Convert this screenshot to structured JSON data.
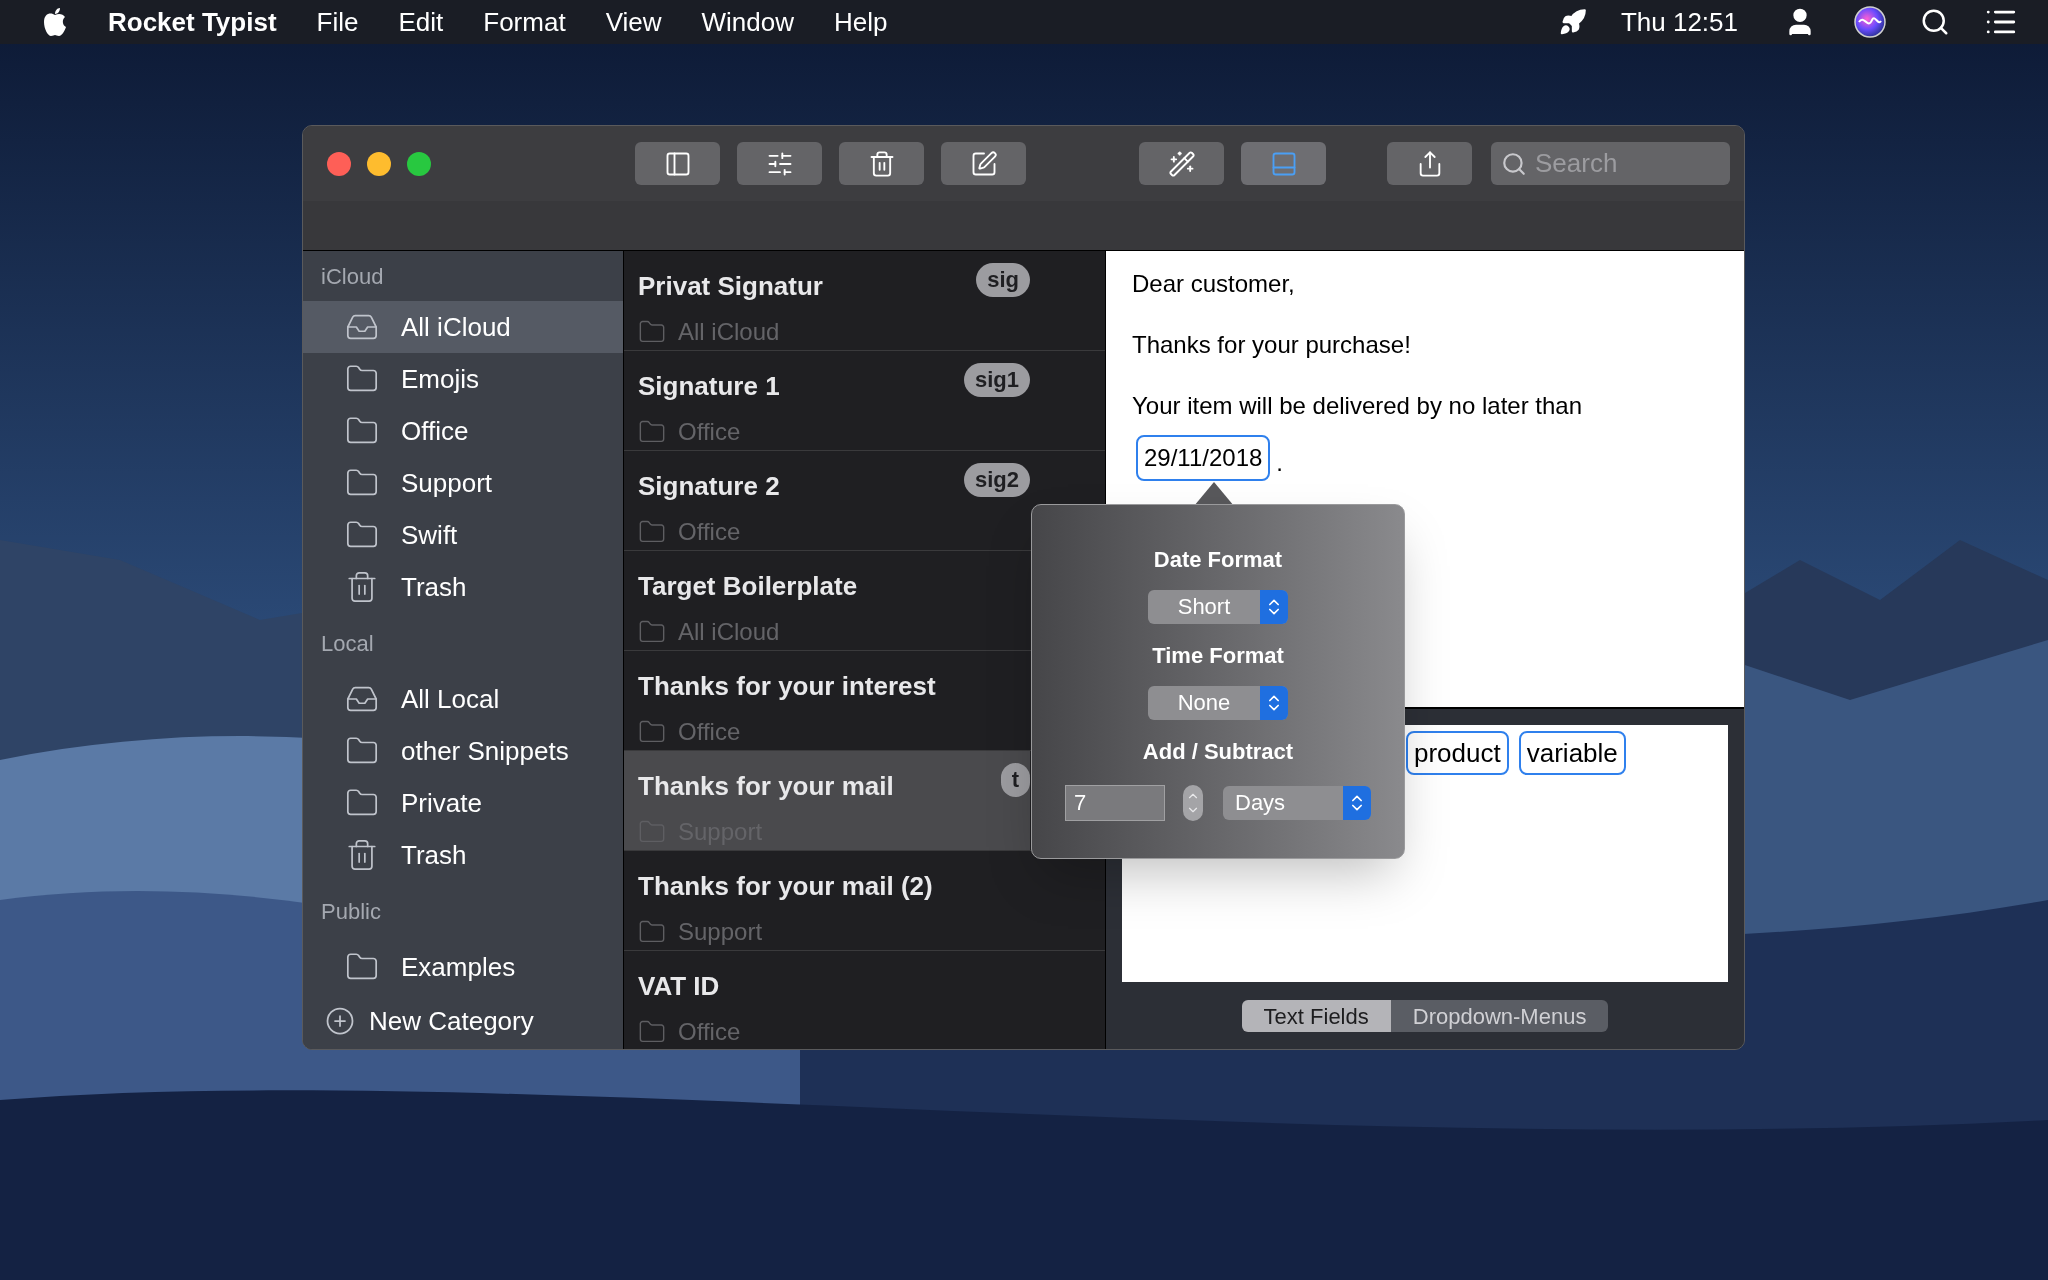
{
  "menu_bar": {
    "app_name": "Rocket Typist",
    "menus": [
      "File",
      "Edit",
      "Format",
      "View",
      "Window",
      "Help"
    ],
    "clock": "Thu 12:51"
  },
  "toolbar": {
    "buttons": [
      {
        "kind": "sidebar",
        "on": false
      },
      {
        "kind": "filters",
        "on": false
      },
      {
        "kind": "trash",
        "on": false
      },
      {
        "kind": "compose",
        "on": false
      },
      {
        "kind": "wand",
        "on": false
      },
      {
        "kind": "preview",
        "on": true
      },
      {
        "kind": "share",
        "on": false
      }
    ],
    "search_placeholder": "Search"
  },
  "sidebar": {
    "sections": [
      {
        "title": "iCloud",
        "items": [
          {
            "label": "All iCloud",
            "kind": "all",
            "selected": true
          },
          {
            "label": "Emojis",
            "kind": "folder",
            "selected": false
          },
          {
            "label": "Office",
            "kind": "folder",
            "selected": false
          },
          {
            "label": "Support",
            "kind": "folder",
            "selected": false
          },
          {
            "label": "Swift",
            "kind": "folder",
            "selected": false
          },
          {
            "label": "Trash",
            "kind": "trash",
            "selected": false
          }
        ]
      },
      {
        "title": "Local",
        "items": [
          {
            "label": "All Local",
            "kind": "all",
            "selected": false
          },
          {
            "label": "other Snippets",
            "kind": "folder",
            "selected": false
          },
          {
            "label": "Private",
            "kind": "folder",
            "selected": false
          },
          {
            "label": "Trash",
            "kind": "trash",
            "selected": false
          }
        ]
      },
      {
        "title": "Public",
        "items": [
          {
            "label": "Examples",
            "kind": "folder",
            "selected": false
          }
        ]
      }
    ],
    "new_category": "New Category"
  },
  "snippets": [
    {
      "title": "Privat Signatur",
      "category": "All iCloud",
      "abbreviation": "sig",
      "selected": false
    },
    {
      "title": "Signature 1",
      "category": "Office",
      "abbreviation": "sig1",
      "selected": false
    },
    {
      "title": "Signature 2",
      "category": "Office",
      "abbreviation": "sig2",
      "selected": false
    },
    {
      "title": "Target Boilerplate",
      "category": "All iCloud",
      "selected": false
    },
    {
      "title": "Thanks for your interest",
      "category": "Office",
      "selected": false
    },
    {
      "title": "Thanks for your mail",
      "category": "Support",
      "abbreviation": "t",
      "selected": true
    },
    {
      "title": "Thanks for your mail (2)",
      "category": "Support",
      "selected": false
    },
    {
      "title": "VAT ID",
      "category": "Office",
      "selected": false
    }
  ],
  "editor": {
    "paragraphs": [
      "Dear customer,",
      "Thanks for your purchase!",
      "Your item will be delivered by no later than"
    ],
    "date_token": "29/11/2018",
    "after_token": ".",
    "tokens": [
      "product",
      "variable"
    ]
  },
  "popover": {
    "date_format_label": "Date Format",
    "date_format": "Short",
    "time_format_label": "Time Format",
    "time_format": "None",
    "offset_label": "Add / Subtract",
    "offset_value": "7",
    "offset_unit": "Days"
  },
  "segments": [
    {
      "label": "Text Fields",
      "selected": true
    },
    {
      "label": "Dropdown-Menus",
      "selected": false
    }
  ]
}
